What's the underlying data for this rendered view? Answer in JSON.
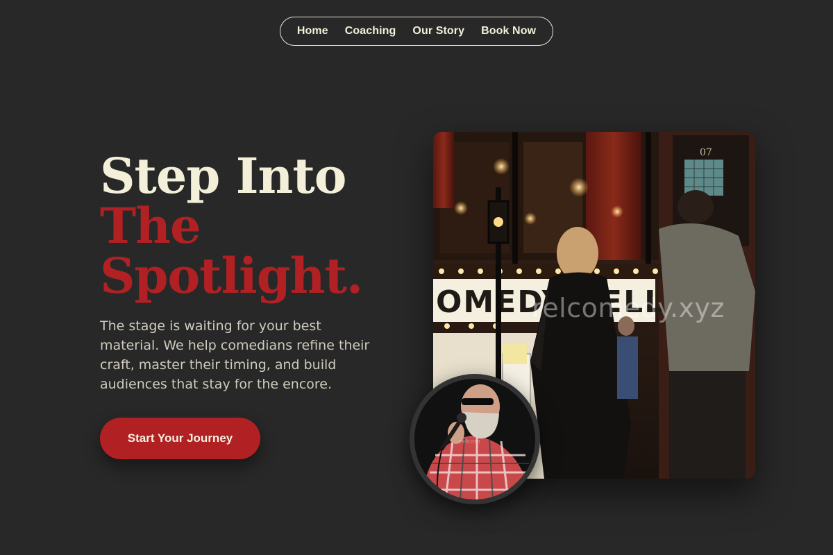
{
  "nav": {
    "items": [
      {
        "label": "Home"
      },
      {
        "label": "Coaching"
      },
      {
        "label": "Our Story"
      },
      {
        "label": "Book Now"
      }
    ]
  },
  "hero": {
    "headline_line1": "Step Into",
    "headline_line2": "The",
    "headline_line3": "Spotlight.",
    "description": "The stage is waiting for your best material. We help comedians refine their craft, master their timing, and build audiences that stay for the encore.",
    "cta_label": "Start Your Journey"
  },
  "media": {
    "main_photo_watermark": "relcomedy.xyz",
    "main_photo_sign": "OMEDY CELLAR",
    "main_photo_door_number": "07",
    "avatar_watermark": "relcom"
  },
  "colors": {
    "background": "#282828",
    "accent": "#b12124",
    "text_cream": "#f3efd9"
  }
}
